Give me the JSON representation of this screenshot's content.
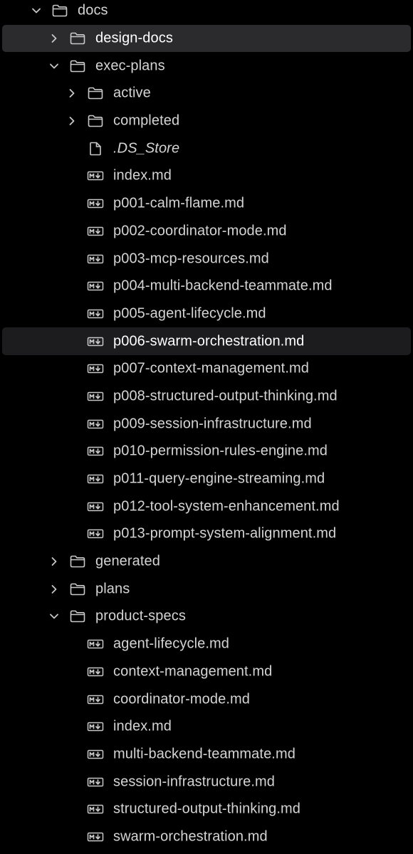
{
  "tree": [
    {
      "name": "docs",
      "type": "folder",
      "expanded": true,
      "depth": 0
    },
    {
      "name": "design-docs",
      "type": "folder",
      "expanded": false,
      "depth": 1,
      "state": "selected"
    },
    {
      "name": "exec-plans",
      "type": "folder",
      "expanded": true,
      "depth": 1
    },
    {
      "name": "active",
      "type": "folder",
      "expanded": false,
      "depth": 2
    },
    {
      "name": "completed",
      "type": "folder",
      "expanded": false,
      "depth": 2
    },
    {
      "name": ".DS_Store",
      "type": "file",
      "depth": 2,
      "italic": true
    },
    {
      "name": "index.md",
      "type": "markdown",
      "depth": 2
    },
    {
      "name": "p001-calm-flame.md",
      "type": "markdown",
      "depth": 2
    },
    {
      "name": "p002-coordinator-mode.md",
      "type": "markdown",
      "depth": 2
    },
    {
      "name": "p003-mcp-resources.md",
      "type": "markdown",
      "depth": 2
    },
    {
      "name": "p004-multi-backend-teammate.md",
      "type": "markdown",
      "depth": 2
    },
    {
      "name": "p005-agent-lifecycle.md",
      "type": "markdown",
      "depth": 2
    },
    {
      "name": "p006-swarm-orchestration.md",
      "type": "markdown",
      "depth": 2,
      "state": "hovered"
    },
    {
      "name": "p007-context-management.md",
      "type": "markdown",
      "depth": 2
    },
    {
      "name": "p008-structured-output-thinking.md",
      "type": "markdown",
      "depth": 2
    },
    {
      "name": "p009-session-infrastructure.md",
      "type": "markdown",
      "depth": 2
    },
    {
      "name": "p010-permission-rules-engine.md",
      "type": "markdown",
      "depth": 2
    },
    {
      "name": "p011-query-engine-streaming.md",
      "type": "markdown",
      "depth": 2
    },
    {
      "name": "p012-tool-system-enhancement.md",
      "type": "markdown",
      "depth": 2
    },
    {
      "name": "p013-prompt-system-alignment.md",
      "type": "markdown",
      "depth": 2
    },
    {
      "name": "generated",
      "type": "folder",
      "expanded": false,
      "depth": 1
    },
    {
      "name": "plans",
      "type": "folder",
      "expanded": false,
      "depth": 1
    },
    {
      "name": "product-specs",
      "type": "folder",
      "expanded": true,
      "depth": 1
    },
    {
      "name": "agent-lifecycle.md",
      "type": "markdown",
      "depth": 2
    },
    {
      "name": "context-management.md",
      "type": "markdown",
      "depth": 2
    },
    {
      "name": "coordinator-mode.md",
      "type": "markdown",
      "depth": 2
    },
    {
      "name": "index.md",
      "type": "markdown",
      "depth": 2
    },
    {
      "name": "multi-backend-teammate.md",
      "type": "markdown",
      "depth": 2
    },
    {
      "name": "session-infrastructure.md",
      "type": "markdown",
      "depth": 2
    },
    {
      "name": "structured-output-thinking.md",
      "type": "markdown",
      "depth": 2
    },
    {
      "name": "swarm-orchestration.md",
      "type": "markdown",
      "depth": 2
    }
  ],
  "icons": {
    "folder": "folder-icon",
    "file": "file-icon",
    "markdown": "markdown-icon",
    "collapsed": "chevron-right-icon",
    "expanded": "chevron-down-icon"
  },
  "colors": {
    "background": "#000000",
    "text": "#d4d4d4",
    "selected_bg": "#2b2b2d",
    "hover_bg": "#1c1c1e",
    "icon": "#c8c8c8"
  }
}
